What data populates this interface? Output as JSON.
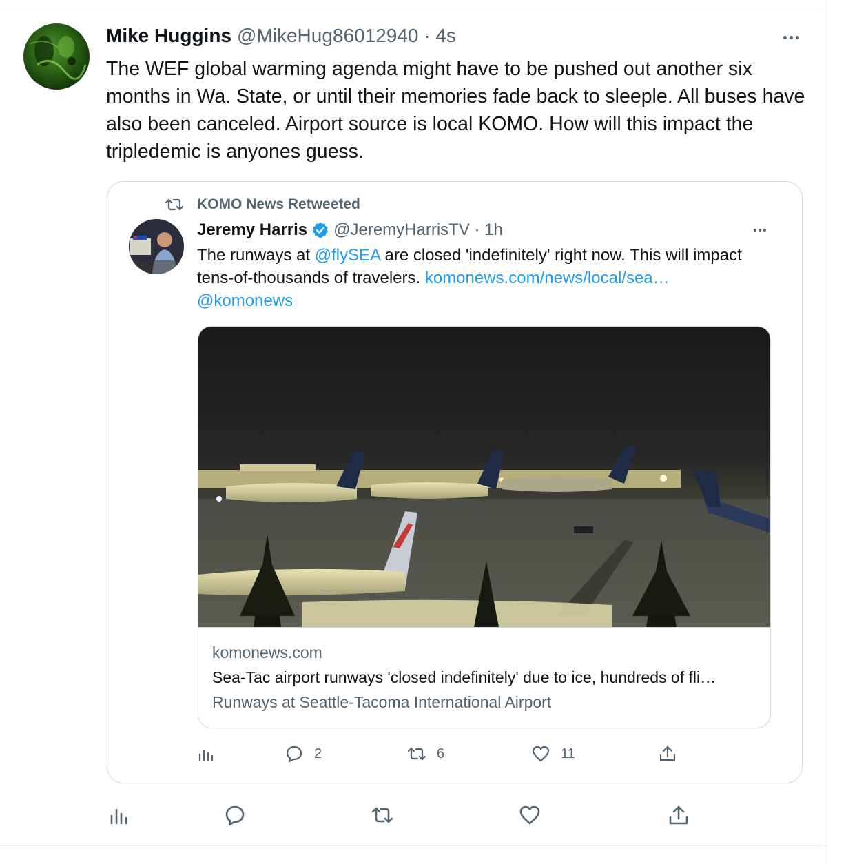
{
  "tweet": {
    "author_name": "Mike Huggins",
    "handle_time": "@MikeHug86012940 · 4s",
    "text": "The WEF global warming agenda might have to be pushed out another six months in Wa. State, or until their memories fade back to sleeple. All buses have also been canceled. Airport source is local KOMO. How will this impact the tripledemic is anyones guess."
  },
  "quoted": {
    "retweeted_by": "KOMO News Retweeted",
    "author_name": "Jeremy Harris",
    "handle_time": "@JeremyHarrisTV · 1h",
    "text_parts": {
      "p1": "The runways at ",
      "mention1": "@flySEA",
      "p2": " are closed 'indefinitely' right now. This will impact tens-of-thousands of travelers. ",
      "url": "komonews.com/news/local/sea…",
      "mention2": "@komonews"
    },
    "card": {
      "domain": "komonews.com",
      "title": "Sea-Tac airport runways 'closed indefinitely' due to ice, hundreds of fli…",
      "description": "Runways at Seattle-Tacoma International Airport"
    },
    "metrics": {
      "replies": "2",
      "retweets": "6",
      "likes": "11"
    }
  },
  "icons": {
    "more": "more-horizontal-icon",
    "retweet": "retweet-icon",
    "verified": "verified-badge-icon",
    "analytics": "analytics-icon",
    "reply": "reply-icon",
    "like": "heart-icon",
    "share": "share-icon"
  },
  "colors": {
    "accent": "#1d9bf0",
    "secondary_text": "#536471",
    "border": "#cfd9de"
  }
}
